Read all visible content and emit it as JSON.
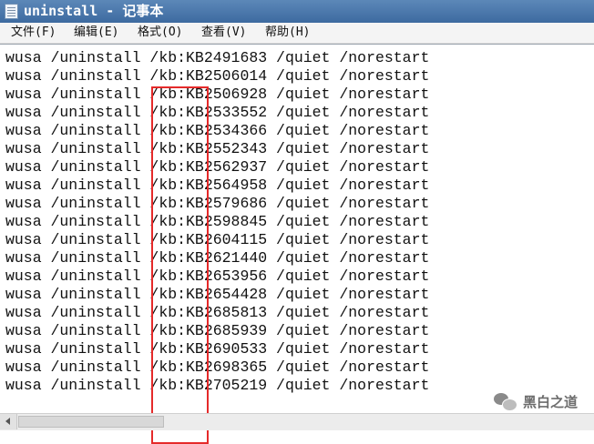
{
  "window": {
    "title": "uninstall - 记事本"
  },
  "menu": [
    "文件(F)",
    "编辑(E)",
    "格式(O)",
    "查看(V)",
    "帮助(H)"
  ],
  "document": {
    "lines": [
      "wusa /uninstall /kb:KB2491683 /quiet /norestart",
      "wusa /uninstall /kb:KB2506014 /quiet /norestart",
      "wusa /uninstall /kb:KB2506928 /quiet /norestart",
      "wusa /uninstall /kb:KB2533552 /quiet /norestart",
      "wusa /uninstall /kb:KB2534366 /quiet /norestart",
      "wusa /uninstall /kb:KB2552343 /quiet /norestart",
      "wusa /uninstall /kb:KB2562937 /quiet /norestart",
      "wusa /uninstall /kb:KB2564958 /quiet /norestart",
      "wusa /uninstall /kb:KB2579686 /quiet /norestart",
      "wusa /uninstall /kb:KB2598845 /quiet /norestart",
      "wusa /uninstall /kb:KB2604115 /quiet /norestart",
      "wusa /uninstall /kb:KB2621440 /quiet /norestart",
      "wusa /uninstall /kb:KB2653956 /quiet /norestart",
      "wusa /uninstall /kb:KB2654428 /quiet /norestart",
      "wusa /uninstall /kb:KB2685813 /quiet /norestart",
      "wusa /uninstall /kb:KB2685939 /quiet /norestart",
      "wusa /uninstall /kb:KB2690533 /quiet /norestart",
      "wusa /uninstall /kb:KB2698365 /quiet /norestart",
      "wusa /uninstall /kb:KB2705219 /quiet /norestart"
    ]
  },
  "annotation": {
    "color": "#e52a2a"
  },
  "watermark": {
    "text": "黑白之道",
    "icon": "wechat-icon"
  }
}
